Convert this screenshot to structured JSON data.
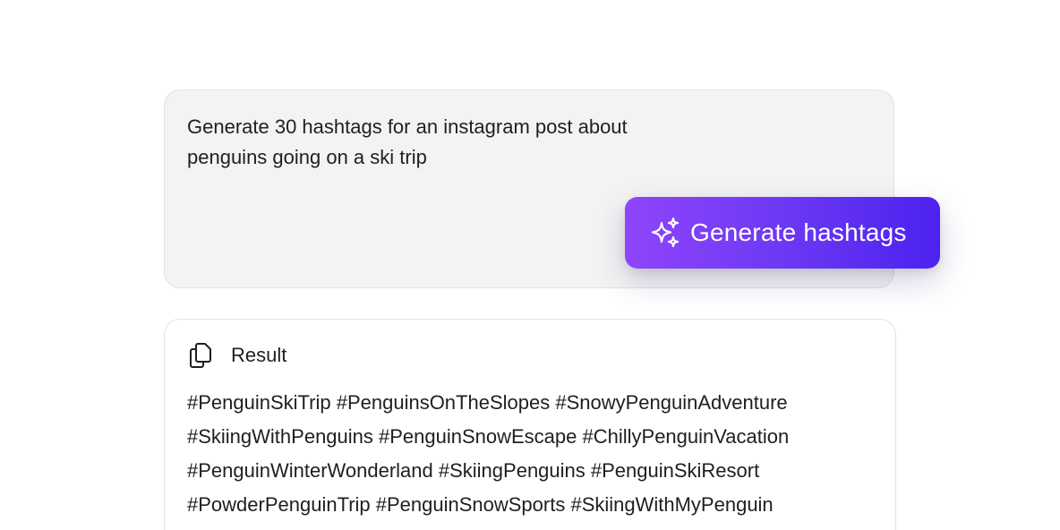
{
  "prompt": {
    "text": "Generate 30 hashtags for an instagram post about\npenguins going on a ski trip"
  },
  "generate_button": {
    "icon": "sparkles-icon",
    "label": "Generate hashtags",
    "gradient_start": "#8f45fb",
    "gradient_end": "#4c22ee"
  },
  "result": {
    "icon": "copy-icon",
    "title": "Result",
    "text": "#PenguinSkiTrip #PenguinsOnTheSlopes #SnowyPenguinAdventure\n#SkiingWithPenguins #PenguinSnowEscape #ChillyPenguinVacation\n#PenguinWinterWonderland #SkiingPenguins #PenguinSkiResort\n#PowderPenguinTrip #PenguinSnowSports #SkiingWithMyPenguin"
  }
}
